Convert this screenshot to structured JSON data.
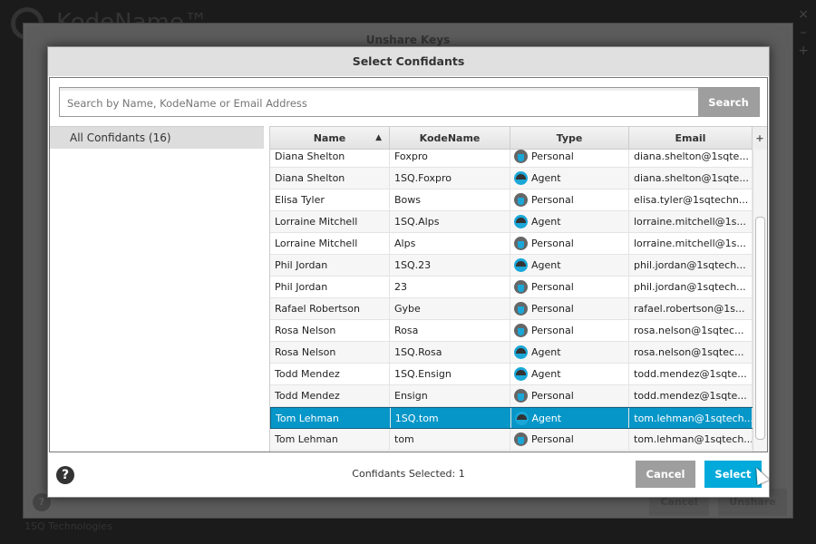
{
  "app": {
    "name": "KodeName™",
    "company": "1SQ Technologies"
  },
  "background_dialog": {
    "title": "Unshare Keys",
    "cancel_label": "Cancel",
    "unshare_label": "Unshare"
  },
  "dialog": {
    "title": "Select Confidants",
    "search": {
      "placeholder": "Search by Name, KodeName or Email Address",
      "button_label": "Search"
    },
    "groups": [
      {
        "label": "All Confidants (16)"
      }
    ],
    "columns": [
      "Name",
      "KodeName",
      "Type",
      "Email"
    ],
    "sort": {
      "column": "Name",
      "direction": "ascending"
    },
    "rows": [
      {
        "name": "Diana Shelton",
        "kodename": "Foxpro",
        "type": "Personal",
        "email": "diana.shelton@1sqte..."
      },
      {
        "name": "Diana Shelton",
        "kodename": "1SQ.Foxpro",
        "type": "Agent",
        "email": "diana.shelton@1sqte..."
      },
      {
        "name": "Elisa Tyler",
        "kodename": "Bows",
        "type": "Personal",
        "email": "elisa.tyler@1sqtechn..."
      },
      {
        "name": "Lorraine Mitchell",
        "kodename": "1SQ.Alps",
        "type": "Agent",
        "email": "lorraine.mitchell@1s..."
      },
      {
        "name": "Lorraine Mitchell",
        "kodename": "Alps",
        "type": "Personal",
        "email": "lorraine.mitchell@1s..."
      },
      {
        "name": "Phil Jordan",
        "kodename": "1SQ.23",
        "type": "Agent",
        "email": "phil.jordan@1sqtech..."
      },
      {
        "name": "Phil Jordan",
        "kodename": "23",
        "type": "Personal",
        "email": "phil.jordan@1sqtech..."
      },
      {
        "name": "Rafael Robertson",
        "kodename": "Gybe",
        "type": "Personal",
        "email": "rafael.robertson@1s..."
      },
      {
        "name": "Rosa Nelson",
        "kodename": "Rosa",
        "type": "Personal",
        "email": "rosa.nelson@1sqtec..."
      },
      {
        "name": "Rosa Nelson",
        "kodename": "1SQ.Rosa",
        "type": "Agent",
        "email": "rosa.nelson@1sqtec..."
      },
      {
        "name": "Todd Mendez",
        "kodename": "1SQ.Ensign",
        "type": "Agent",
        "email": "todd.mendez@1sqte..."
      },
      {
        "name": "Todd Mendez",
        "kodename": "Ensign",
        "type": "Personal",
        "email": "todd.mendez@1sqte..."
      },
      {
        "name": "Tom Lehman",
        "kodename": "1SQ.tom",
        "type": "Agent",
        "email": "tom.lehman@1sqtech...",
        "selected": true
      },
      {
        "name": "Tom Lehman",
        "kodename": "tom",
        "type": "Personal",
        "email": "tom.lehman@1sqtech..."
      }
    ],
    "selected_count_text": "Confidants Selected: 1",
    "cancel_label": "Cancel",
    "select_label": "Select",
    "colors": {
      "accent": "#02aadb",
      "selected_row": "#0796c8",
      "cancel": "#9e9e9e"
    }
  }
}
